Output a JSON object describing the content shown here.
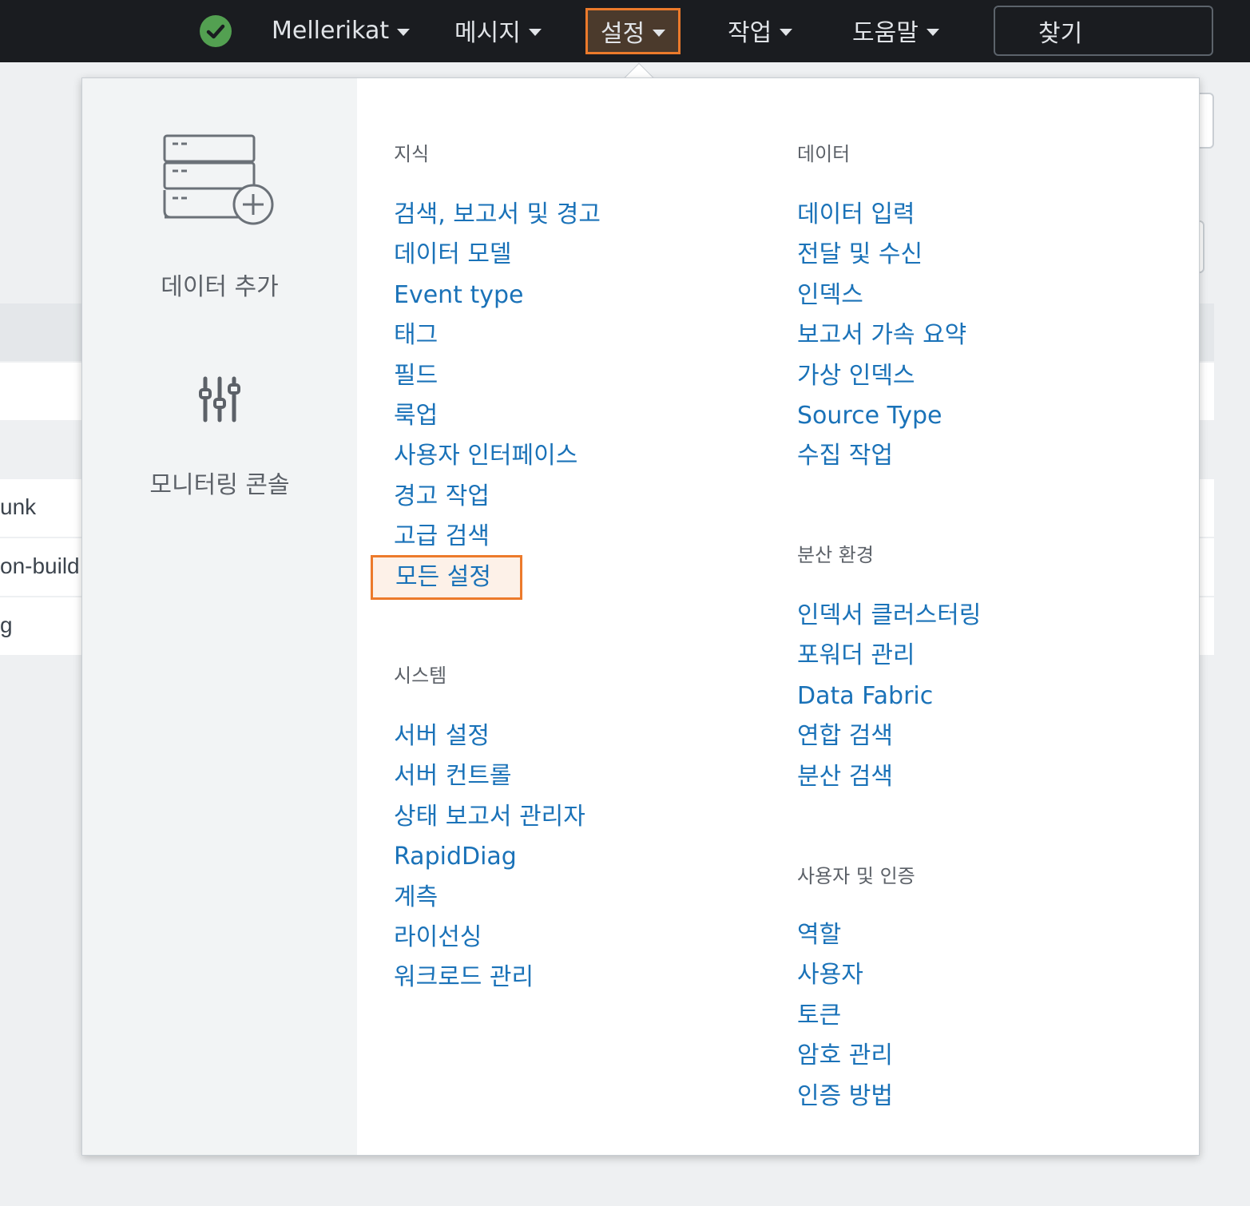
{
  "topbar": {
    "user_menu": "Mellerikat",
    "nav": [
      "메시지",
      "설정",
      "작업",
      "도움말"
    ],
    "find_label": "찾기"
  },
  "background": {
    "fragments": [
      "unk",
      "on-build",
      "g"
    ]
  },
  "left_panel": {
    "add_data": "데이터 추가",
    "monitoring_console": "모니터링 콘솔"
  },
  "sections": {
    "knowledge": {
      "title": "지식",
      "items": [
        "검색, 보고서 및 경고",
        "데이터 모델",
        "Event type",
        "태그",
        "필드",
        "룩업",
        "사용자 인터페이스",
        "경고 작업",
        "고급 검색",
        "모든 설정"
      ]
    },
    "system": {
      "title": "시스템",
      "items": [
        "서버 설정",
        "서버 컨트롤",
        "상태 보고서 관리자",
        "RapidDiag",
        "계측",
        "라이선싱",
        "워크로드 관리"
      ]
    },
    "data": {
      "title": "데이터",
      "items": [
        "데이터 입력",
        "전달 및 수신",
        "인덱스",
        "보고서 가속 요약",
        "가상 인덱스",
        "Source Type",
        "수집 작업"
      ]
    },
    "distributed": {
      "title": "분산 환경",
      "items": [
        "인덱서 클러스터링",
        "포워더 관리",
        "Data Fabric",
        "연합 검색",
        "분산 검색"
      ]
    },
    "users_auth": {
      "title": "사용자 및 인증",
      "items": [
        "역할",
        "사용자",
        "토큰",
        "암호 관리",
        "인증 방법"
      ]
    }
  },
  "colors": {
    "topbar_bg": "#1a1c20",
    "link": "#1a72b8",
    "highlight": "#ec7a2b",
    "status_ok": "#53a051"
  }
}
